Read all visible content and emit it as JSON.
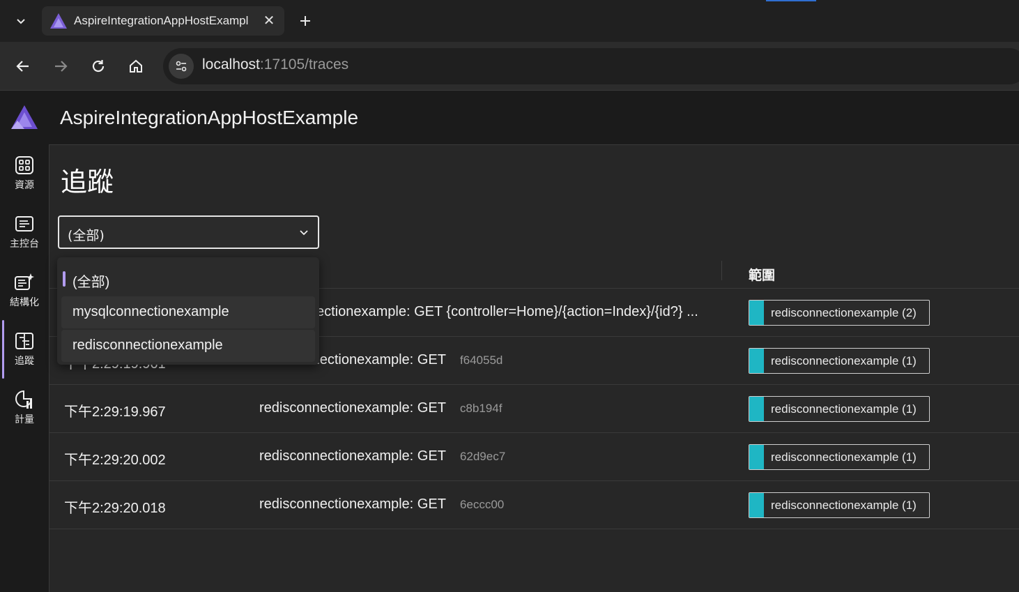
{
  "browser": {
    "tab_title": "AspireIntegrationAppHostExample",
    "close_glyph": "✕",
    "url_host": "localhost",
    "url_rest": ":17105/traces"
  },
  "app": {
    "title": "AspireIntegrationAppHostExample"
  },
  "sidebar": {
    "items": [
      {
        "label": "資源",
        "icon": "grid-icon"
      },
      {
        "label": "主控台",
        "icon": "console-icon"
      },
      {
        "label": "結構化",
        "icon": "structured-logs-icon"
      },
      {
        "label": "追蹤",
        "icon": "traces-icon"
      },
      {
        "label": "計量",
        "icon": "metrics-icon"
      }
    ],
    "active": "追蹤"
  },
  "page": {
    "title": "追蹤"
  },
  "filter": {
    "selected": "(全部)",
    "options": [
      "(全部)",
      "mysqlconnectionexample",
      "redisconnectionexample"
    ]
  },
  "table": {
    "span_header": "範圍",
    "rows": [
      {
        "time": "",
        "name": "ectionexample: GET {controller=Home}/{action=Index}/{id?} ...",
        "trace_id": "",
        "span": "redisconnectionexample (2)"
      },
      {
        "time": "下午2:29:19.961",
        "name": "redisconnectionexample: GET",
        "trace_id": "f64055d",
        "span": "redisconnectionexample (1)"
      },
      {
        "time": "下午2:29:19.967",
        "name": "redisconnectionexample: GET",
        "trace_id": "c8b194f",
        "span": "redisconnectionexample (1)"
      },
      {
        "time": "下午2:29:20.002",
        "name": "redisconnectionexample: GET",
        "trace_id": "62d9ec7",
        "span": "redisconnectionexample (1)"
      },
      {
        "time": "下午2:29:20.018",
        "name": "redisconnectionexample: GET",
        "trace_id": "6eccc00",
        "span": "redisconnectionexample (1)"
      }
    ]
  },
  "colors": {
    "accent": "#b29cf0",
    "span_color": "#1fb6c4"
  }
}
